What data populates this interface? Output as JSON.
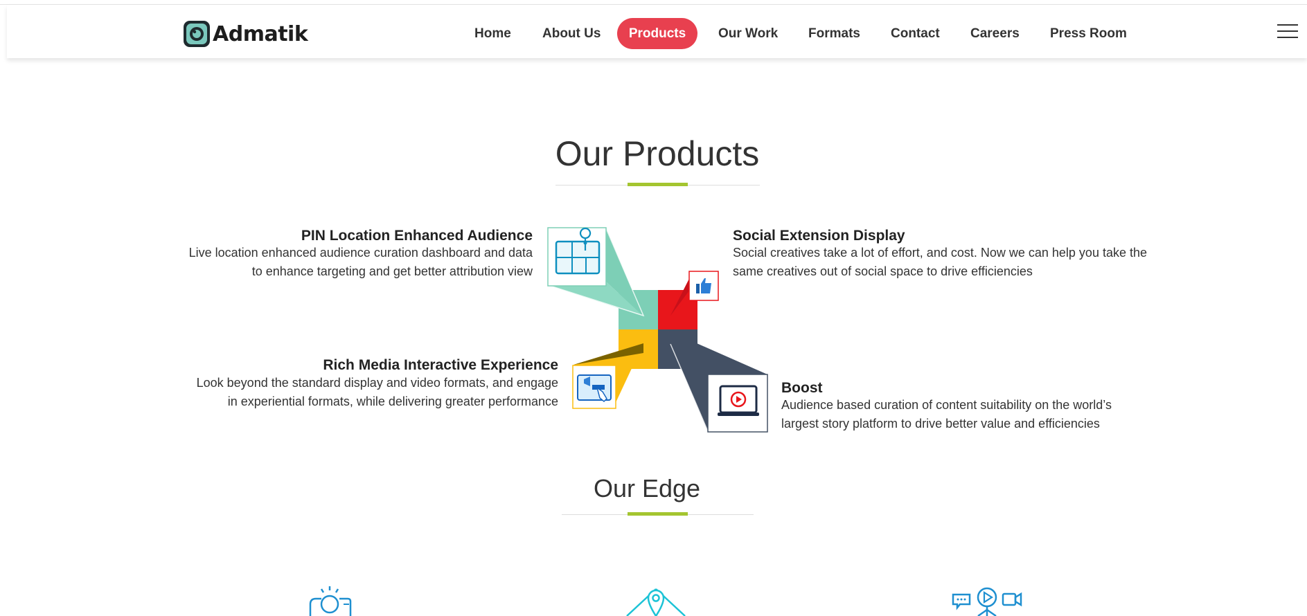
{
  "brand": {
    "name": "Admatik"
  },
  "nav": {
    "items": [
      {
        "label": "Home"
      },
      {
        "label": "About Us"
      },
      {
        "label": "Products",
        "active": true
      },
      {
        "label": "Our Work"
      },
      {
        "label": "Formats"
      },
      {
        "label": "Contact"
      },
      {
        "label": "Careers"
      },
      {
        "label": "Press Room"
      }
    ],
    "active_color": "#e8404f"
  },
  "products": {
    "heading": "Our Products",
    "items": [
      {
        "title": "PIN Location Enhanced Audience",
        "desc": "Live location enhanced audience curation dashboard and data to enhance targeting and get better attribution view",
        "color": "#7dcfb6",
        "icon": "map-pin-dashboard-icon"
      },
      {
        "title": "Social Extension Display",
        "desc": "Social creatives take a lot of effort, and cost. Now we can help you take the same creatives out of social space to drive efficiencies",
        "color": "#e8161b",
        "icon": "thumbs-up-icon"
      },
      {
        "title": "Rich Media Interactive Experience",
        "desc": "Look beyond the standard display and video formats, and engage in experiential formats, while delivering greater performance",
        "color": "#fbbd10",
        "icon": "interactive-tablet-icon"
      },
      {
        "title": "Boost",
        "desc": "Audience based curation of content suitability on the world’s largest story platform to drive better value and efficiencies",
        "color": "#435064",
        "icon": "video-play-icon"
      }
    ]
  },
  "edge": {
    "heading": "Our Edge",
    "icons": [
      "lightbulb-idea-icon",
      "location-pin-network-icon",
      "media-chat-video-icon"
    ]
  },
  "colors": {
    "accent_green": "#a4c530",
    "text": "#333333"
  }
}
